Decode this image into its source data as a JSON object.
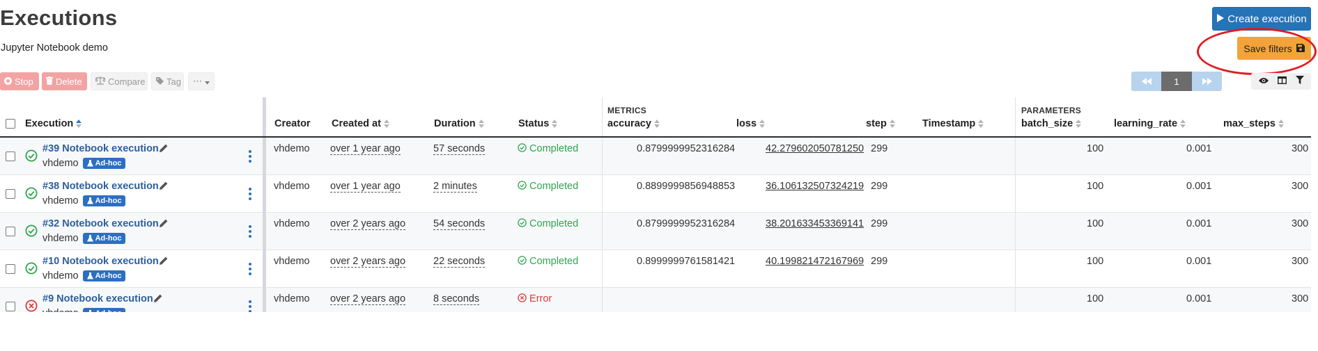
{
  "page": {
    "title": "Executions",
    "subtitle": "Jupyter Notebook demo"
  },
  "actions": {
    "create_label": "Create execution",
    "save_filters_label": "Save filters"
  },
  "toolbar": {
    "stop": "Stop",
    "delete": "Delete",
    "compare": "Compare",
    "tag": "Tag",
    "more": "⋯"
  },
  "pagination": {
    "current_page": "1"
  },
  "columns": {
    "execution": "Execution",
    "creator": "Creator",
    "created_at": "Created at",
    "duration": "Duration",
    "status": "Status",
    "metrics_group": "METRICS",
    "accuracy": "accuracy",
    "loss": "loss",
    "step": "step",
    "timestamp": "Timestamp",
    "parameters_group": "PARAMETERS",
    "batch_size": "batch_size",
    "learning_rate": "learning_rate",
    "max_steps": "max_steps"
  },
  "badge_label": "Ad-hoc",
  "rows": [
    {
      "name": "#39 Notebook execution",
      "owner": "vhdemo",
      "creator": "vhdemo",
      "created": "over 1 year ago",
      "duration": "57 seconds",
      "status": "Completed",
      "state": "ok",
      "accuracy": "0.8799999952316284",
      "loss": "42.279602050781250",
      "step": "299",
      "batch_size": "100",
      "learning_rate": "0.001",
      "max_steps": "300"
    },
    {
      "name": "#38 Notebook execution",
      "owner": "vhdemo",
      "creator": "vhdemo",
      "created": "over 1 year ago",
      "duration": "2 minutes",
      "status": "Completed",
      "state": "ok",
      "accuracy": "0.8899999856948853",
      "loss": "36.106132507324219",
      "step": "299",
      "batch_size": "100",
      "learning_rate": "0.001",
      "max_steps": "300"
    },
    {
      "name": "#32 Notebook execution",
      "owner": "vhdemo",
      "creator": "vhdemo",
      "created": "over 2 years ago",
      "duration": "54 seconds",
      "status": "Completed",
      "state": "ok",
      "accuracy": "0.8799999952316284",
      "loss": "38.201633453369141",
      "step": "299",
      "batch_size": "100",
      "learning_rate": "0.001",
      "max_steps": "300"
    },
    {
      "name": "#10 Notebook execution",
      "owner": "vhdemo",
      "creator": "vhdemo",
      "created": "over 2 years ago",
      "duration": "22 seconds",
      "status": "Completed",
      "state": "ok",
      "accuracy": "0.8999999761581421",
      "loss": "40.199821472167969",
      "step": "299",
      "batch_size": "100",
      "learning_rate": "0.001",
      "max_steps": "300"
    },
    {
      "name": "#9 Notebook execution",
      "owner": "vhdemo",
      "creator": "vhdemo",
      "created": "over 2 years ago",
      "duration": "8 seconds",
      "status": "Error",
      "state": "err",
      "accuracy": "",
      "loss": "",
      "step": "",
      "batch_size": "100",
      "learning_rate": "0.001",
      "max_steps": "300"
    }
  ],
  "colors": {
    "primary": "#2574b7",
    "warning": "#f3a33a",
    "success": "#2fa44f",
    "danger": "#d93b3b",
    "annotation": "#e01b22"
  }
}
